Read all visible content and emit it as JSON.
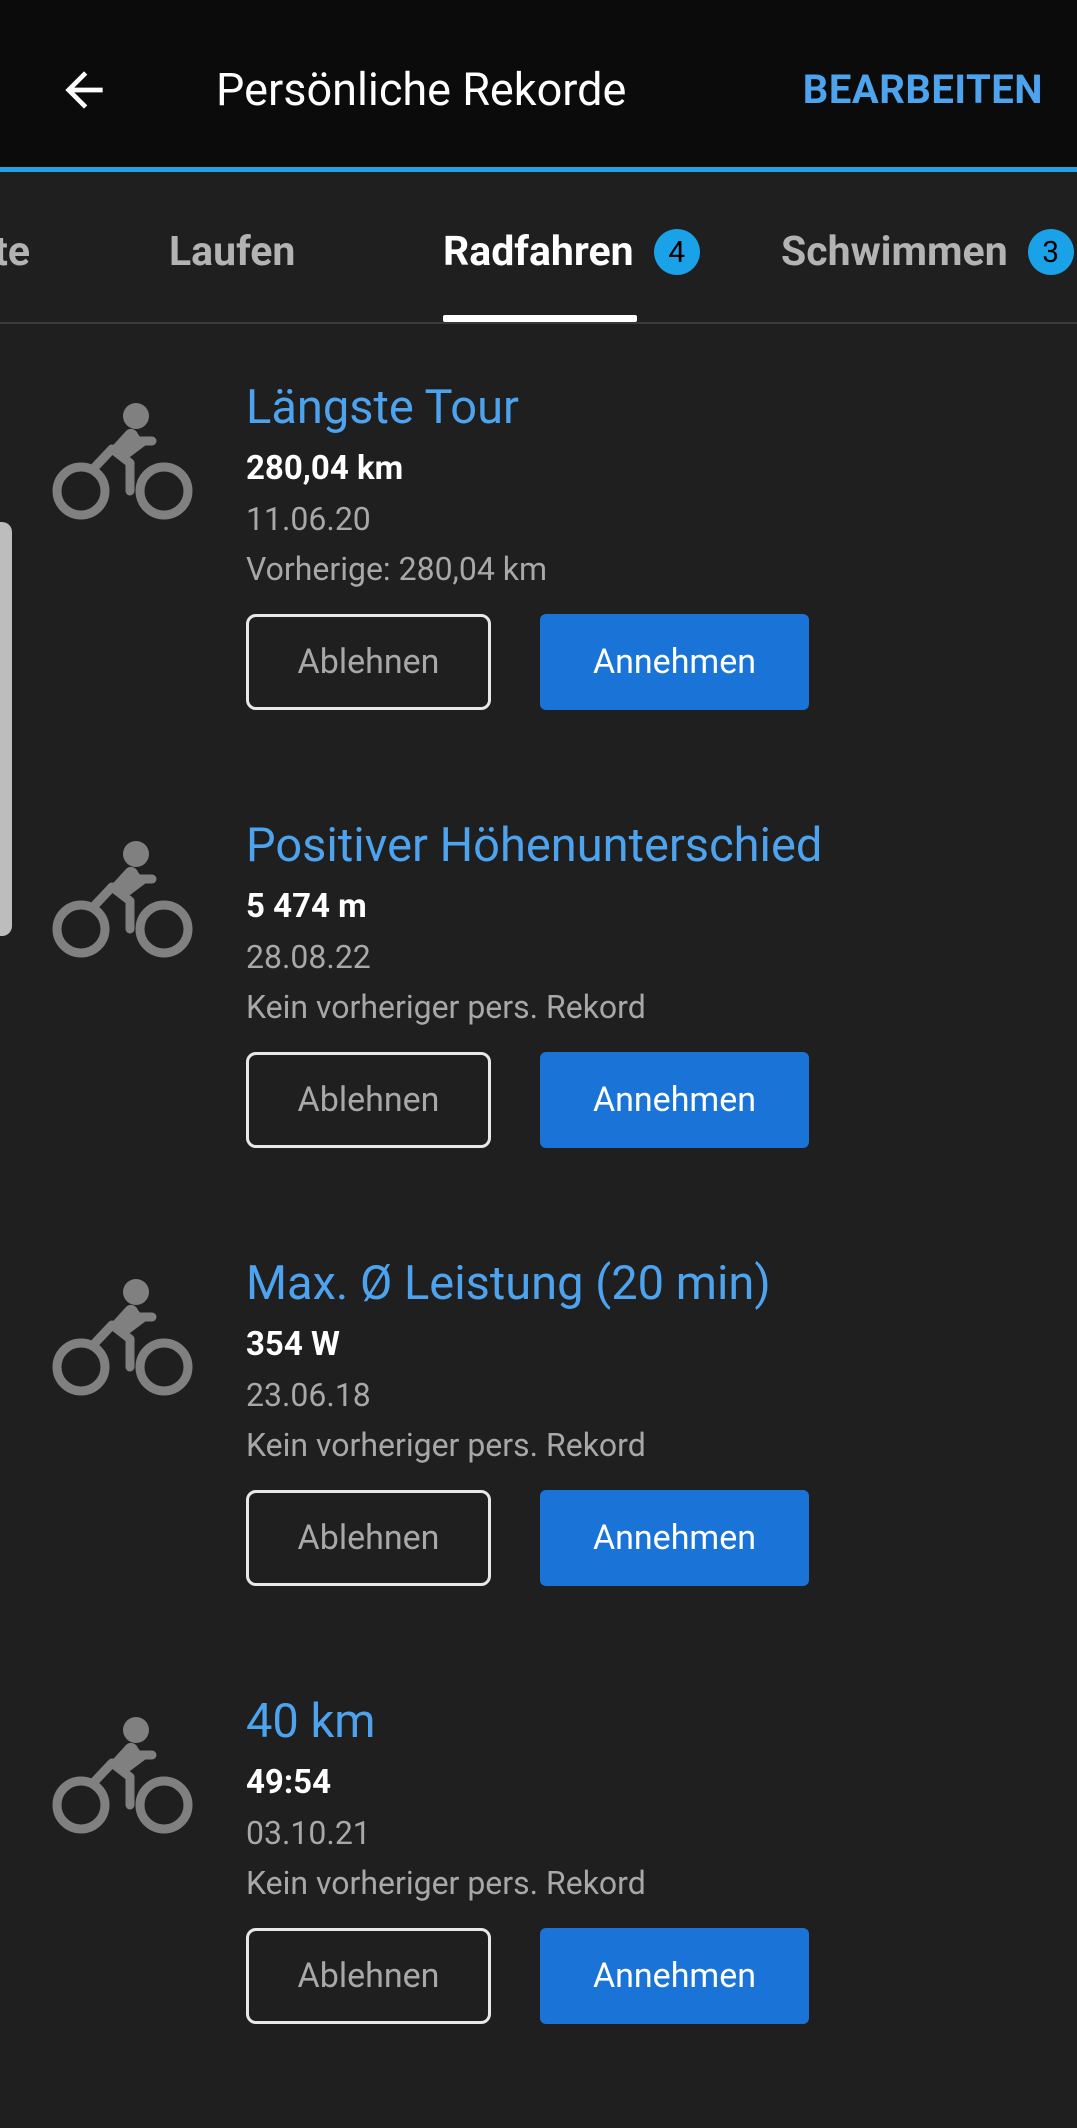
{
  "app_bar": {
    "title": "Persönliche Rekorde",
    "edit_label": "BEARBEITEN"
  },
  "tabs": [
    {
      "label": "te",
      "badge": null,
      "active": false
    },
    {
      "label": "Laufen",
      "badge": null,
      "active": false
    },
    {
      "label": "Radfahren",
      "badge": "4",
      "active": true
    },
    {
      "label": "Schwimmen",
      "badge": "3",
      "active": false
    }
  ],
  "records": [
    {
      "title": "Längste Tour",
      "value": "280,04 km",
      "date": "11.06.20",
      "previous": "Vorherige: 280,04 km",
      "decline_label": "Ablehnen",
      "accept_label": "Annehmen",
      "icon": "cyclist-icon"
    },
    {
      "title": "Positiver Höhenunterschied",
      "value": "5 474 m",
      "date": "28.08.22",
      "previous": "Kein vorheriger pers. Rekord",
      "decline_label": "Ablehnen",
      "accept_label": "Annehmen",
      "icon": "cyclist-icon"
    },
    {
      "title": "Max. Ø Leistung (20 min)",
      "value": "354 W",
      "date": "23.06.18",
      "previous": "Kein vorheriger pers. Rekord",
      "decline_label": "Ablehnen",
      "accept_label": "Annehmen",
      "icon": "cyclist-icon"
    },
    {
      "title": "40 km",
      "value": "49:54",
      "date": "03.10.21",
      "previous": "Kein vorheriger pers. Rekord",
      "decline_label": "Ablehnen",
      "accept_label": "Annehmen",
      "icon": "cyclist-icon"
    }
  ],
  "colors": {
    "accent": "#1fa3e8",
    "title_blue": "#4da3ee",
    "accept_button": "#1a74d8",
    "background": "#1f1f1f",
    "app_bar": "#0b0b0b"
  }
}
